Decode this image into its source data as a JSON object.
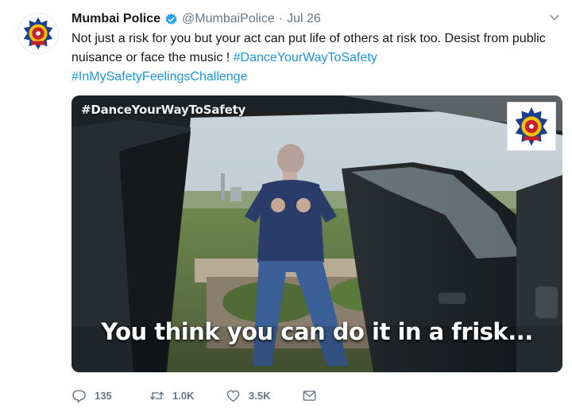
{
  "colors": {
    "link": "#1b95e0",
    "muted": "#657786",
    "verified": "#1da1f2",
    "text": "#14171a"
  },
  "tweet": {
    "display_name": "Mumbai Police",
    "verified_icon": "verified-badge-icon",
    "handle": "@MumbaiPolice",
    "separator": "·",
    "date": "Jul 26",
    "menu_icon": "chevron-down-icon",
    "text_main": "Not just a risk for you but your act can put life of others at risk too. Desist from public nuisance or face the music ! ",
    "hashtag_1": "#DanceYourWayToSafety",
    "hashtag_2": "#InMySafetyFeelingsChallenge"
  },
  "media": {
    "overlay_tag": "#DanceYourWayToSafety",
    "caption": "You think you can do it in a frisk..."
  },
  "actions": {
    "reply": {
      "icon": "reply-icon",
      "count": "135"
    },
    "retweet": {
      "icon": "retweet-icon",
      "count": "1.0K"
    },
    "like": {
      "icon": "heart-icon",
      "count": "3.5K"
    },
    "dm": {
      "icon": "envelope-icon"
    }
  }
}
